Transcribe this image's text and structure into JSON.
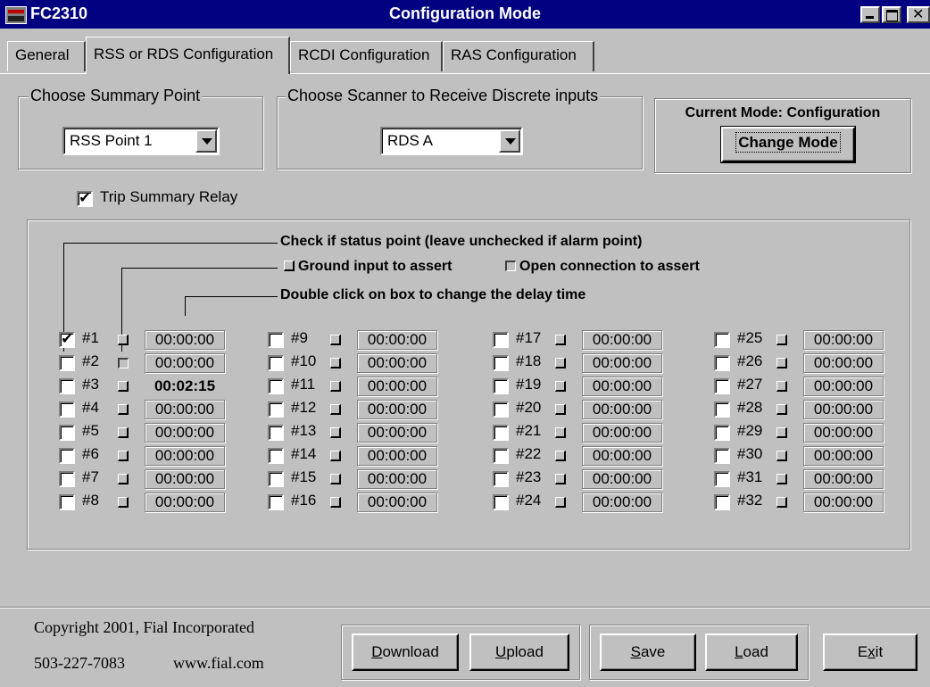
{
  "window": {
    "app_name": "FC2310",
    "title": "Configuration Mode"
  },
  "tabs": [
    {
      "label": "General"
    },
    {
      "label": "RSS or RDS Configuration",
      "active": true
    },
    {
      "label": "RCDI Configuration"
    },
    {
      "label": "RAS Configuration"
    }
  ],
  "summary": {
    "legend": "Choose Summary Point",
    "value": "RSS Point 1"
  },
  "scanner": {
    "legend": "Choose Scanner to Receive Discrete inputs",
    "value": "RDS A"
  },
  "mode": {
    "label": "Current Mode: Configuration",
    "button": "Change Mode"
  },
  "trip": {
    "label": "Trip Summary Relay",
    "checked": true
  },
  "instructions": {
    "status": "Check if status point (leave unchecked if alarm point)",
    "ground": "Ground input to assert",
    "open": "Open connection to assert",
    "delay": "Double click on box to change the delay time"
  },
  "points": [
    {
      "label": "#1",
      "status": true,
      "open": false,
      "delay": "00:00:00"
    },
    {
      "label": "#2",
      "status": false,
      "open": true,
      "delay": "00:00:00"
    },
    {
      "label": "#3",
      "status": false,
      "open": false,
      "delay": "00:02:15",
      "bold": true
    },
    {
      "label": "#4",
      "status": false,
      "open": false,
      "delay": "00:00:00"
    },
    {
      "label": "#5",
      "status": false,
      "open": false,
      "delay": "00:00:00"
    },
    {
      "label": "#6",
      "status": false,
      "open": false,
      "delay": "00:00:00"
    },
    {
      "label": "#7",
      "status": false,
      "open": false,
      "delay": "00:00:00"
    },
    {
      "label": "#8",
      "status": false,
      "open": false,
      "delay": "00:00:00"
    },
    {
      "label": "#9",
      "status": false,
      "open": false,
      "delay": "00:00:00"
    },
    {
      "label": "#10",
      "status": false,
      "open": false,
      "delay": "00:00:00"
    },
    {
      "label": "#11",
      "status": false,
      "open": false,
      "delay": "00:00:00"
    },
    {
      "label": "#12",
      "status": false,
      "open": false,
      "delay": "00:00:00"
    },
    {
      "label": "#13",
      "status": false,
      "open": false,
      "delay": "00:00:00"
    },
    {
      "label": "#14",
      "status": false,
      "open": false,
      "delay": "00:00:00"
    },
    {
      "label": "#15",
      "status": false,
      "open": false,
      "delay": "00:00:00"
    },
    {
      "label": "#16",
      "status": false,
      "open": false,
      "delay": "00:00:00"
    },
    {
      "label": "#17",
      "status": false,
      "open": false,
      "delay": "00:00:00"
    },
    {
      "label": "#18",
      "status": false,
      "open": false,
      "delay": "00:00:00"
    },
    {
      "label": "#19",
      "status": false,
      "open": false,
      "delay": "00:00:00"
    },
    {
      "label": "#20",
      "status": false,
      "open": false,
      "delay": "00:00:00"
    },
    {
      "label": "#21",
      "status": false,
      "open": false,
      "delay": "00:00:00"
    },
    {
      "label": "#22",
      "status": false,
      "open": false,
      "delay": "00:00:00"
    },
    {
      "label": "#23",
      "status": false,
      "open": false,
      "delay": "00:00:00"
    },
    {
      "label": "#24",
      "status": false,
      "open": false,
      "delay": "00:00:00"
    },
    {
      "label": "#25",
      "status": false,
      "open": false,
      "delay": "00:00:00"
    },
    {
      "label": "#26",
      "status": false,
      "open": false,
      "delay": "00:00:00"
    },
    {
      "label": "#27",
      "status": false,
      "open": false,
      "delay": "00:00:00"
    },
    {
      "label": "#28",
      "status": false,
      "open": false,
      "delay": "00:00:00"
    },
    {
      "label": "#29",
      "status": false,
      "open": false,
      "delay": "00:00:00"
    },
    {
      "label": "#30",
      "status": false,
      "open": false,
      "delay": "00:00:00"
    },
    {
      "label": "#31",
      "status": false,
      "open": false,
      "delay": "00:00:00"
    },
    {
      "label": "#32",
      "status": false,
      "open": false,
      "delay": "00:00:00"
    }
  ],
  "footer": {
    "copyright": "Copyright 2001, Fial Incorporated",
    "phone": "503-227-7083",
    "website": "www.fial.com"
  },
  "buttons": {
    "download": {
      "label": "Download",
      "accel_index": 0
    },
    "upload": {
      "label": "Upload",
      "accel_index": 0
    },
    "save": {
      "label": "Save",
      "accel_index": 0
    },
    "load": {
      "label": "Load",
      "accel_index": 0
    },
    "exit": {
      "label": "Exit",
      "accel_index": 1
    }
  }
}
